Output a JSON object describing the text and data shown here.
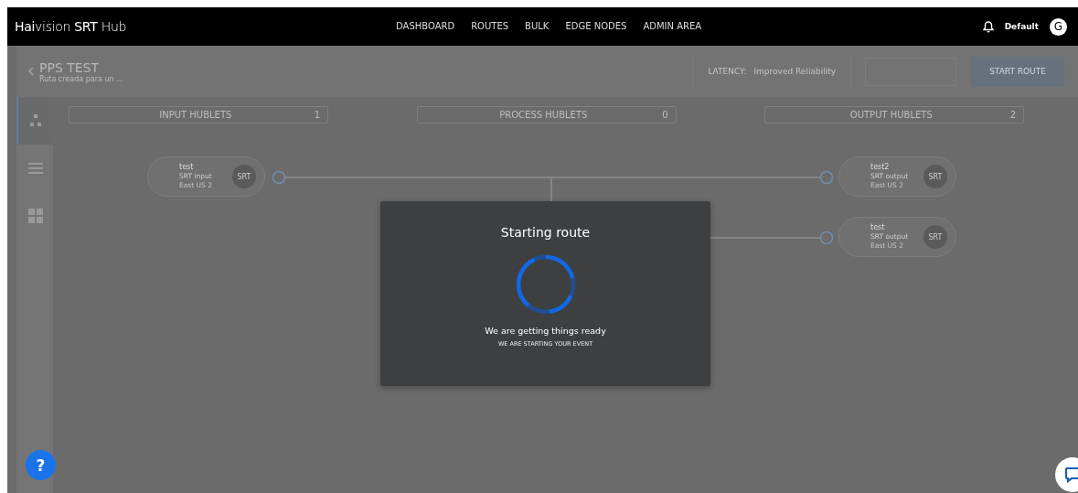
{
  "navbar": {
    "logo": "**Hai**vision **SRT** Hub",
    "items": [
      {
        "label": "DASHBOARD",
        "selected": false
      },
      {
        "label": "ROUTES",
        "selected": false
      },
      {
        "label": "BULK",
        "selected": false
      },
      {
        "label": "EDGE NODES",
        "selected": false
      },
      {
        "label": "ADMIN AREA",
        "selected": false
      }
    ],
    "user": "Default",
    "avatar": "G"
  },
  "route": {
    "title": "PPS TEST",
    "description": "Ruta creada para un ...",
    "latency_label": "LATENCY:",
    "latency_value": "Improved Reliability",
    "start_button": "START ROUTE"
  },
  "sidebar": {
    "items": [
      {
        "kind": "flow",
        "selected": true
      },
      {
        "kind": "list",
        "selected": false
      },
      {
        "kind": "grid",
        "selected": false
      }
    ]
  },
  "columns": [
    {
      "title": "INPUT HUBLETS",
      "count": "1"
    },
    {
      "title": "PROCESS HUBLETS",
      "count": "0"
    },
    {
      "title": "OUTPUT HUBLETS",
      "count": "2"
    }
  ],
  "inputs": [
    {
      "name": "test",
      "type": "SRT input",
      "region": "East US 2",
      "badge": "SRT"
    }
  ],
  "outputs": [
    {
      "name": "test2",
      "type": "SRT output",
      "region": "East US 2",
      "badge": "SRT"
    },
    {
      "name": "test",
      "type": "SRT output",
      "region": "East US 2",
      "badge": "SRT"
    }
  ],
  "modal": {
    "title": "Starting route",
    "message": "We are getting things ready",
    "caption": "WE ARE STARTING YOUR EVENT"
  },
  "help_button": "?"
}
